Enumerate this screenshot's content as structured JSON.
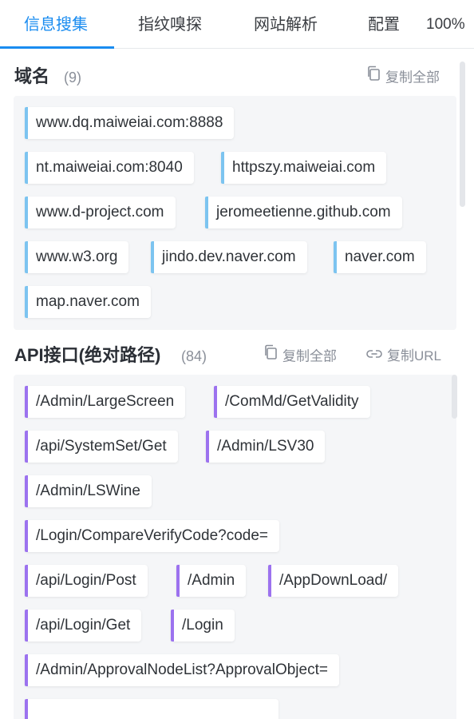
{
  "tabs": [
    {
      "label": "信息搜集"
    },
    {
      "label": "指纹嗅探"
    },
    {
      "label": "网站解析"
    },
    {
      "label": "配置"
    }
  ],
  "zoom": "100%",
  "domain_section": {
    "title": "域名",
    "count": "(9)",
    "copy_all": "复制全部",
    "items": [
      "www.dq.maiweiai.com:8888",
      "nt.maiweiai.com:8040",
      "httpszy.maiweiai.com",
      "www.d-project.com",
      "jeromeetienne.github.com",
      "www.w3.org",
      "jindo.dev.naver.com",
      "naver.com",
      "map.naver.com"
    ]
  },
  "api_section": {
    "title": "API接口(绝对路径)",
    "count": "(84)",
    "copy_all": "复制全部",
    "copy_url": "复制URL",
    "items": [
      "/Admin/LargeScreen",
      "/ComMd/GetValidity",
      "/api/SystemSet/Get",
      "/Admin/LSV30",
      "/Admin/LSWine",
      "/Login/CompareVerifyCode?code=",
      "/api/Login/Post",
      "/Admin",
      "/AppDownLoad/",
      "/api/Login/Get",
      "/Login",
      "/Admin/ApprovalNodeList?ApprovalObject="
    ]
  },
  "colors": {
    "accent": "#1a8cf0",
    "domain_bar": "#7cc4f0",
    "api_bar": "#9c72ef"
  }
}
